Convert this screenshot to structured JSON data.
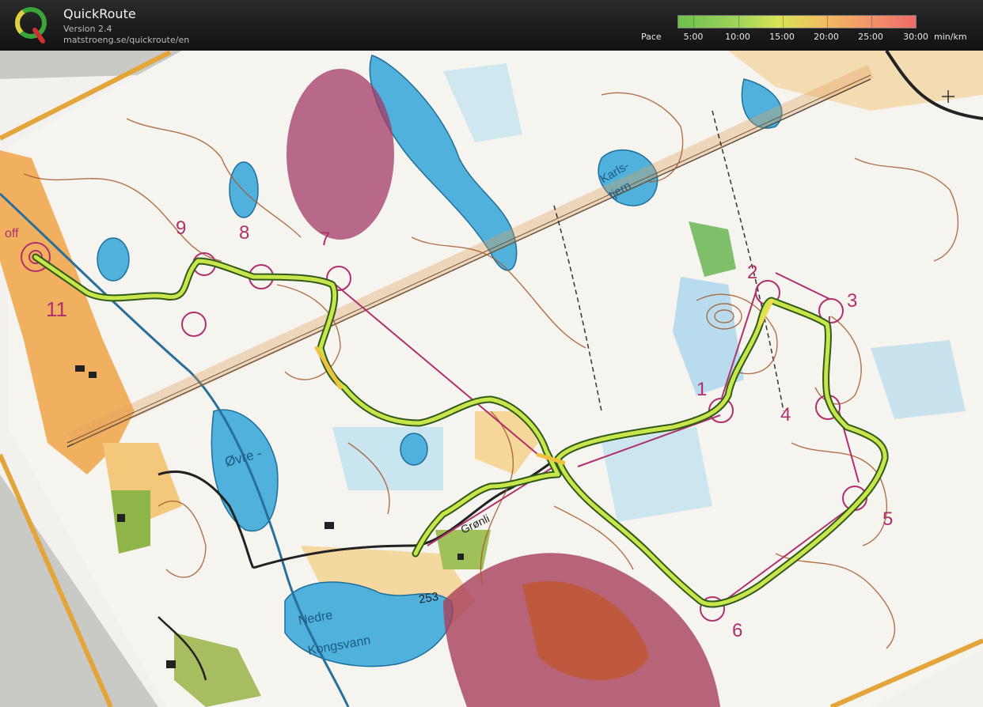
{
  "app": {
    "title": "QuickRoute",
    "version": "Version 2.4",
    "url": "matstroeng.se/quickroute/en"
  },
  "pace_legend": {
    "label": "Pace",
    "marks": [
      "5:00",
      "10:00",
      "15:00",
      "20:00",
      "25:00",
      "30:00"
    ],
    "unit": "min/km",
    "colors": [
      "#6fbf4e",
      "#9fd35a",
      "#d8e456",
      "#f0c060",
      "#f19a6a",
      "#ef6b6b"
    ]
  },
  "map": {
    "place_names": [
      "Karls-",
      "tjern",
      "Øvre -",
      "Nedre",
      "Kongsvann",
      "Grønli"
    ],
    "spot_height": "253",
    "control_numbers": [
      "1",
      "2",
      "3",
      "4",
      "5",
      "6",
      "7",
      "8",
      "9",
      "11"
    ],
    "start_label": "off",
    "route_color": "#c8e64a",
    "course_color": "#b0306a"
  }
}
